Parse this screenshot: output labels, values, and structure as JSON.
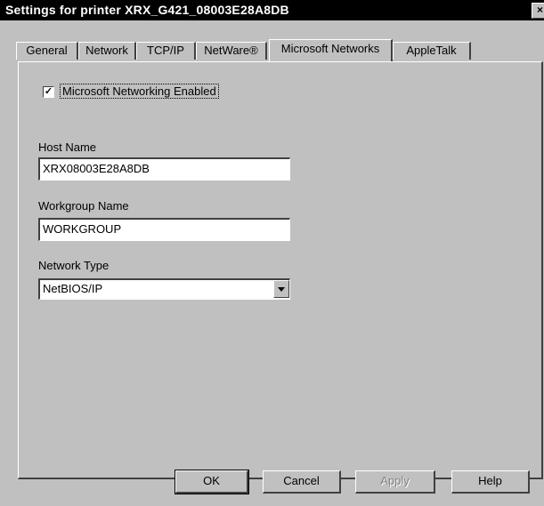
{
  "window": {
    "title": "Settings for printer XRX_G421_08003E28A8DB",
    "close_glyph": "×"
  },
  "tabs": [
    {
      "label": "General"
    },
    {
      "label": "Network"
    },
    {
      "label": "TCP/IP"
    },
    {
      "label": "NetWare®"
    },
    {
      "label": "Microsoft Networks",
      "active": true
    },
    {
      "label": "AppleTalk"
    }
  ],
  "panel": {
    "checkbox_label": "Microsoft Networking Enabled",
    "checkbox_checked": true,
    "checkbox_mark": "✓",
    "host_name_label": "Host Name",
    "host_name_value": "XRX08003E28A8DB",
    "workgroup_label": "Workgroup Name",
    "workgroup_value": "WORKGROUP",
    "network_type_label": "Network Type",
    "network_type_value": "NetBIOS/IP"
  },
  "buttons": {
    "ok": "OK",
    "cancel": "Cancel",
    "apply": "Apply",
    "help": "Help"
  }
}
